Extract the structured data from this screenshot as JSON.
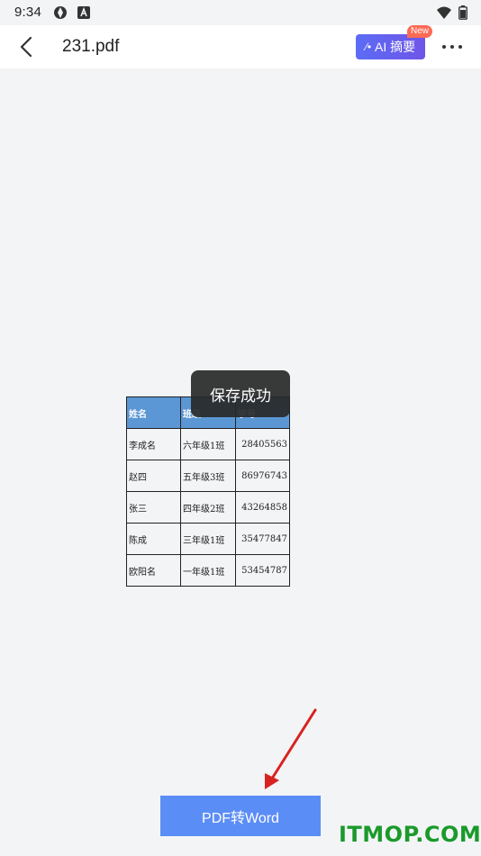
{
  "status_bar": {
    "time": "9:34"
  },
  "app_bar": {
    "file_name": "231.pdf",
    "ai_button_label": "AI 摘要",
    "ai_badge": "New"
  },
  "table": {
    "headers": [
      "姓名",
      "班级",
      "学号"
    ],
    "rows": [
      [
        "李成名",
        "六年级1班",
        "28405563"
      ],
      [
        "赵四",
        "五年级3班",
        "86976743"
      ],
      [
        "张三",
        "四年级2班",
        "43264858"
      ],
      [
        "陈成",
        "三年级1班",
        "35477847"
      ],
      [
        "欧阳名",
        "一年级1班",
        "53454787"
      ]
    ]
  },
  "toast": {
    "message": "保存成功"
  },
  "actions": {
    "convert_label": "PDF转Word"
  },
  "watermark": {
    "text": "ITMOP.COM"
  },
  "colors": {
    "header_bg": "#5b97d4",
    "primary_button": "#5b8df6",
    "ai_gradient_start": "#5b6cf5",
    "ai_gradient_end": "#6f55e8",
    "badge": "#ff6a55",
    "arrow": "#d8221f",
    "watermark": "#1a9a2a"
  },
  "icons": {
    "back": "back-arrow-icon",
    "more": "more-dots-icon",
    "ai": "ai-spark-icon",
    "wifi": "wifi-icon",
    "battery": "battery-icon"
  }
}
